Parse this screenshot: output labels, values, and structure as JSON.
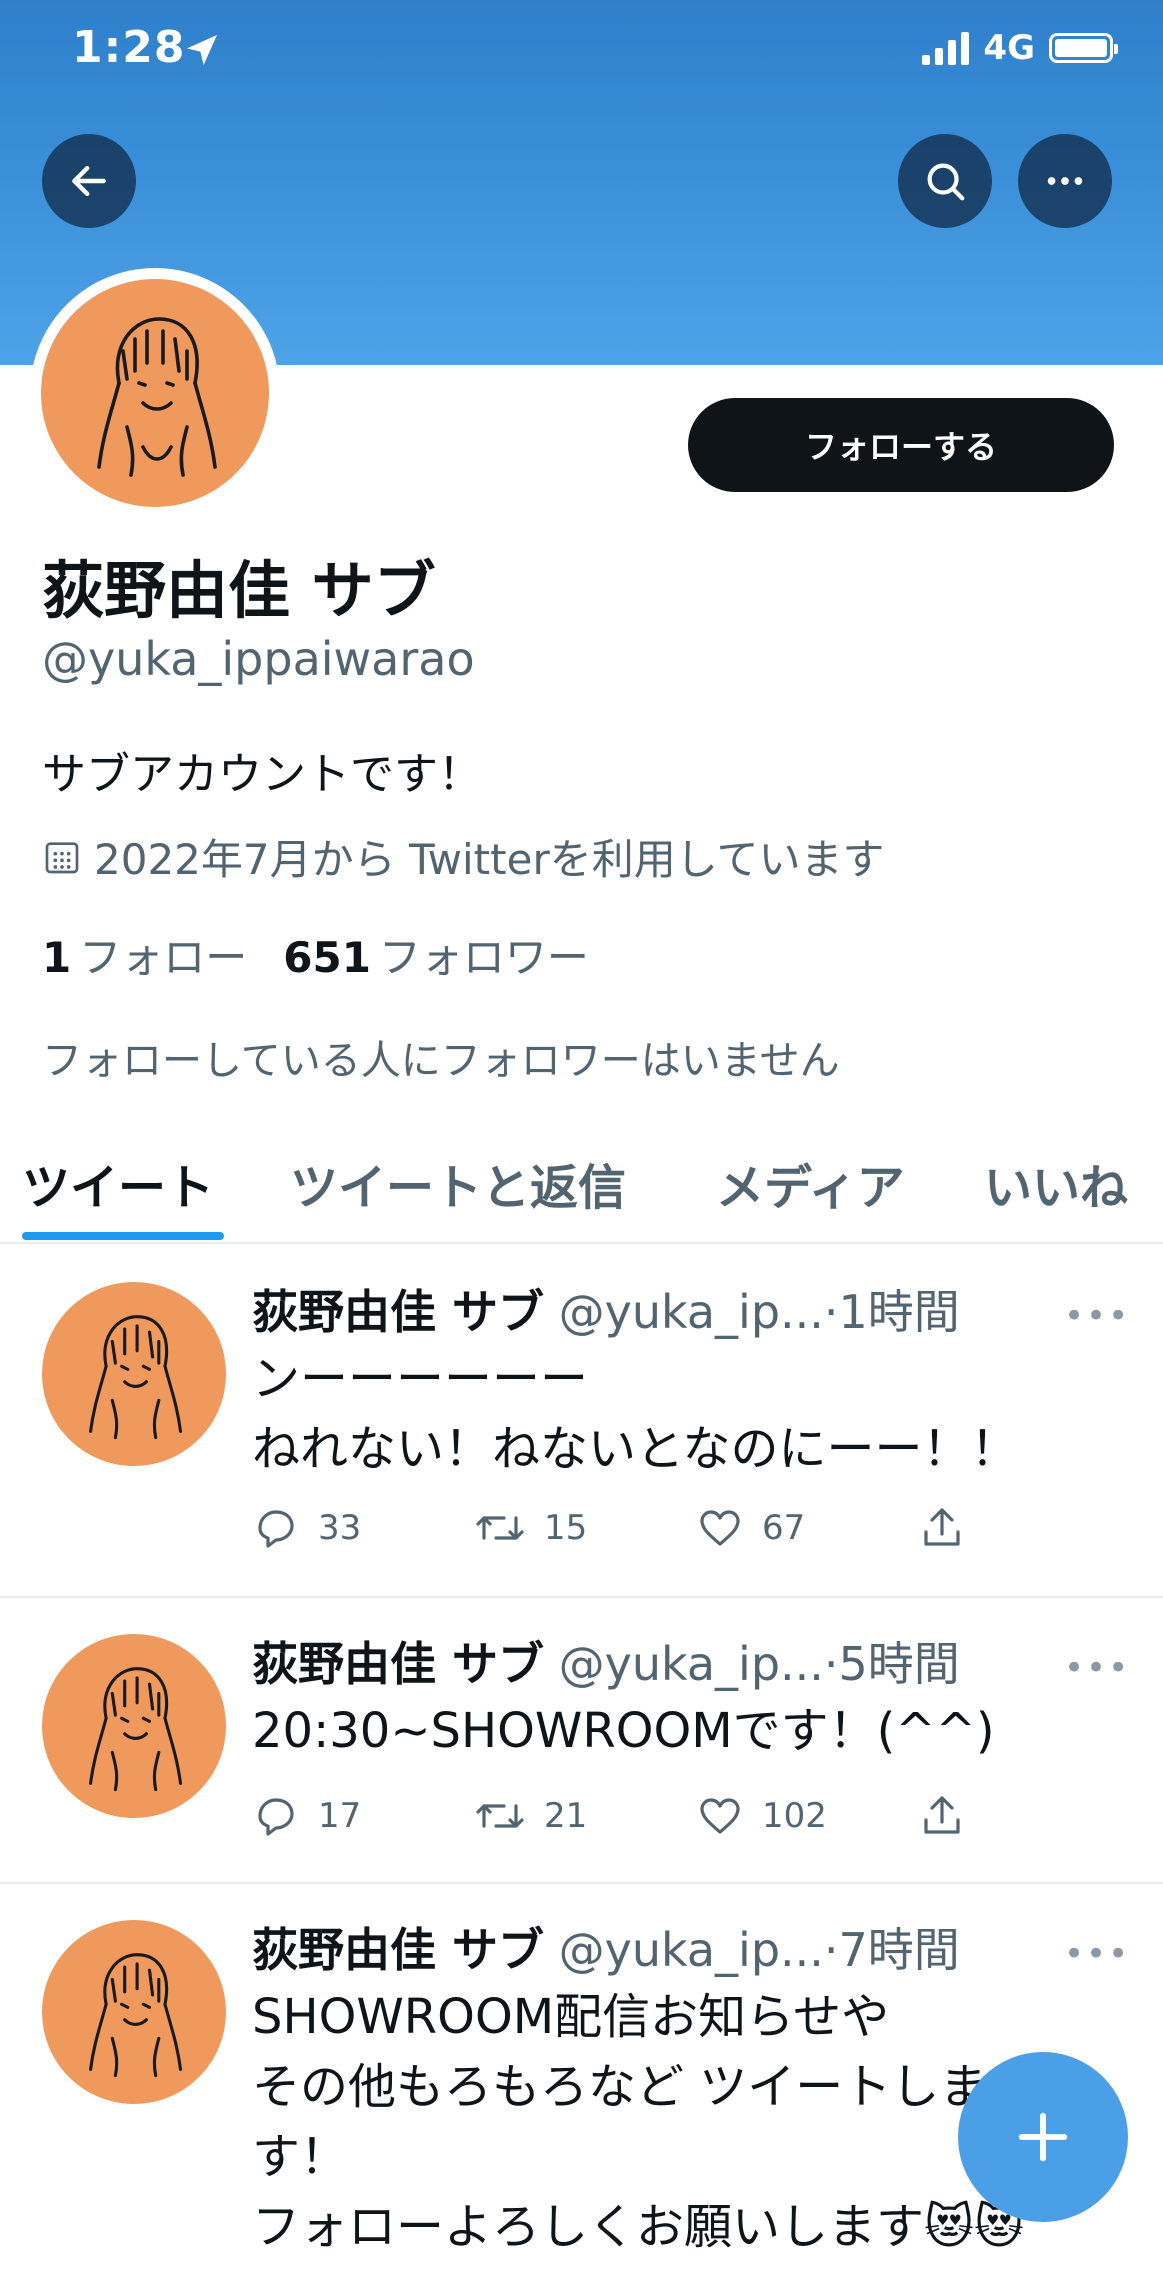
{
  "status": {
    "time": "1:28",
    "network": "4G"
  },
  "profile": {
    "follow_label": "フォローする",
    "display_name": "荻野由佳 サブ",
    "handle": "@yuka_ippaiwarao",
    "bio": "サブアカウントです！",
    "joined": "2022年7月から Twitterを利用しています",
    "following_count": "1",
    "following_label": "フォロー",
    "followers_count": "651",
    "followers_label": "フォロワー",
    "no_mutual_text": "フォローしている人にフォロワーはいません"
  },
  "tabs": [
    {
      "label": "ツイート"
    },
    {
      "label": "ツイートと返信"
    },
    {
      "label": "メディア"
    },
    {
      "label": "いいね"
    }
  ],
  "tweets": [
    {
      "name": "荻野由佳 サブ",
      "handle": "@yuka_ip...",
      "time": "·1時間",
      "text": "ンーーーーーー\nねれない！ねないとなのにーー！！",
      "replies": "33",
      "retweets": "15",
      "likes": "67"
    },
    {
      "name": "荻野由佳 サブ",
      "handle": "@yuka_ip...",
      "time": "·5時間",
      "text": "20:30~SHOWROOMです！(^^)",
      "replies": "17",
      "retweets": "21",
      "likes": "102"
    },
    {
      "name": "荻野由佳 サブ",
      "handle": "@yuka_ip...",
      "time": "·7時間",
      "text": "SHOWROOM配信お知らせや\nその他もろもろなど ツイートしま\nす！\nフォローよろしくお願いします😻😻"
    }
  ],
  "colors": {
    "accent": "#1d9bf0",
    "avatar_bg": "#f0995c",
    "fab": "#4a9fe6"
  }
}
